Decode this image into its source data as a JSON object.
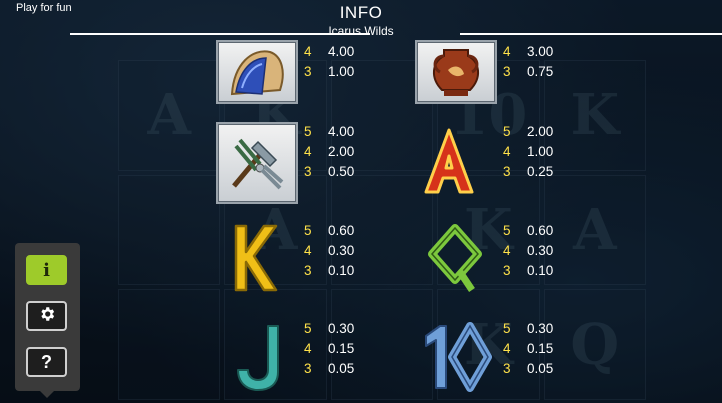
{
  "header": {
    "play_mode": "Play for fun",
    "title": "INFO",
    "subtitle": "Icarus Wilds"
  },
  "paytable": {
    "helmet": {
      "icon": "winged-helmet-icon",
      "pays": [
        {
          "count": "4",
          "value": "4.00"
        },
        {
          "count": "3",
          "value": "1.00"
        }
      ]
    },
    "vase": {
      "icon": "greek-vase-icon",
      "pays": [
        {
          "count": "4",
          "value": "3.00"
        },
        {
          "count": "3",
          "value": "0.75"
        }
      ]
    },
    "tools": {
      "icon": "pliers-hammer-icon",
      "pays": [
        {
          "count": "5",
          "value": "4.00"
        },
        {
          "count": "4",
          "value": "2.00"
        },
        {
          "count": "3",
          "value": "0.50"
        }
      ]
    },
    "a": {
      "icon": "letter-a-icon",
      "glyph": "A",
      "pays": [
        {
          "count": "5",
          "value": "2.00"
        },
        {
          "count": "4",
          "value": "1.00"
        },
        {
          "count": "3",
          "value": "0.25"
        }
      ]
    },
    "k": {
      "icon": "letter-k-icon",
      "glyph": "K",
      "pays": [
        {
          "count": "5",
          "value": "0.60"
        },
        {
          "count": "4",
          "value": "0.30"
        },
        {
          "count": "3",
          "value": "0.10"
        }
      ]
    },
    "q": {
      "icon": "letter-q-icon",
      "glyph": "Q",
      "pays": [
        {
          "count": "5",
          "value": "0.60"
        },
        {
          "count": "4",
          "value": "0.30"
        },
        {
          "count": "3",
          "value": "0.10"
        }
      ]
    },
    "j": {
      "icon": "letter-j-icon",
      "glyph": "J",
      "pays": [
        {
          "count": "5",
          "value": "0.30"
        },
        {
          "count": "4",
          "value": "0.15"
        },
        {
          "count": "3",
          "value": "0.05"
        }
      ]
    },
    "ten": {
      "icon": "number-10-icon",
      "glyph": "10",
      "pays": [
        {
          "count": "5",
          "value": "0.30"
        },
        {
          "count": "4",
          "value": "0.15"
        },
        {
          "count": "3",
          "value": "0.05"
        }
      ]
    }
  },
  "menu": {
    "info": {
      "icon": "info-icon",
      "glyph": "i",
      "active": true
    },
    "settings": {
      "icon": "gear-icon"
    },
    "help": {
      "icon": "question-icon",
      "glyph": "?"
    }
  },
  "background": {
    "reel_symbols": [
      "A",
      "K",
      "",
      "10",
      "K",
      "",
      "A",
      "",
      "K",
      "A",
      "",
      "",
      "",
      "K",
      "Q"
    ]
  },
  "colors": {
    "accent": "#9ecb2a",
    "pay_count": "#ffe24a",
    "letter_a": "#e23b1c",
    "letter_k": "#f2c21b",
    "letter_q": "#7cc83d",
    "letter_j": "#3fb2a8",
    "number_10": "#6f9fd8"
  }
}
